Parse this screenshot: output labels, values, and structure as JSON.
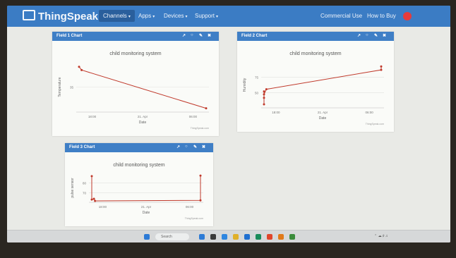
{
  "nav": {
    "logo": "ThingSpeak™",
    "items": [
      {
        "label": "Channels",
        "caret": "▾"
      },
      {
        "label": "Apps",
        "caret": "▾"
      },
      {
        "label": "Devices",
        "caret": "▾"
      },
      {
        "label": "Support",
        "caret": "▾"
      }
    ],
    "commercial": "Commercial Use",
    "howtobuy": "How to Buy",
    "accent": "#3b7cc4"
  },
  "icons": {
    "launch": "↗",
    "comment": "○",
    "edit": "✎",
    "close": "✖"
  },
  "panels": [
    {
      "title": "Field 1 Chart"
    },
    {
      "title": "Field 2 Chart"
    },
    {
      "title": "Field 3 Chart"
    }
  ],
  "chart_data": [
    {
      "type": "line",
      "title": "child monitoring system",
      "xlabel": "Date",
      "ylabel": "Temperature",
      "x_ticks": [
        "18:00",
        "21. Apr",
        "06:00"
      ],
      "y_ticks": [
        "35"
      ],
      "credit": "ThingSpeak.com",
      "color": "#c0392b",
      "points": [
        [
          0.0,
          0.93
        ],
        [
          0.02,
          0.86
        ],
        [
          1.0,
          0.05
        ]
      ]
    },
    {
      "type": "line",
      "title": "child monitoring system",
      "xlabel": "Date",
      "ylabel": "Humidity",
      "x_ticks": [
        "18:00",
        "21. Apr",
        "06:00"
      ],
      "y_ticks": [
        "75",
        "50"
      ],
      "credit": "ThingSpeak.com",
      "color": "#c0392b",
      "points": [
        [
          0.0,
          0.05
        ],
        [
          0.0,
          0.2
        ],
        [
          0.0,
          0.35
        ],
        [
          0.0,
          0.28
        ],
        [
          0.02,
          0.4
        ],
        [
          1.0,
          0.85
        ],
        [
          1.0,
          0.93
        ]
      ]
    },
    {
      "type": "line",
      "title": "child monitoring system",
      "xlabel": "Date",
      "ylabel": "pulse sensor",
      "x_ticks": [
        "18:00",
        "21. Apr",
        "06:00"
      ],
      "y_ticks": [
        "80",
        "70"
      ],
      "credit": "ThingSpeak.com",
      "color": "#c0392b",
      "points": [
        [
          0.0,
          0.95
        ],
        [
          0.0,
          0.05
        ],
        [
          0.02,
          0.08
        ],
        [
          0.03,
          0.0
        ],
        [
          1.0,
          0.02
        ],
        [
          1.0,
          0.97
        ]
      ]
    }
  ],
  "taskbar": {
    "search": "Search",
    "icon_colors": [
      "#2d7bd6",
      "#3a3a3a",
      "#2f86e0",
      "#e0b02a",
      "#1f6fd0",
      "#1a8c5a",
      "#e0452a",
      "#e07a1a",
      "#3b8c3b"
    ]
  }
}
